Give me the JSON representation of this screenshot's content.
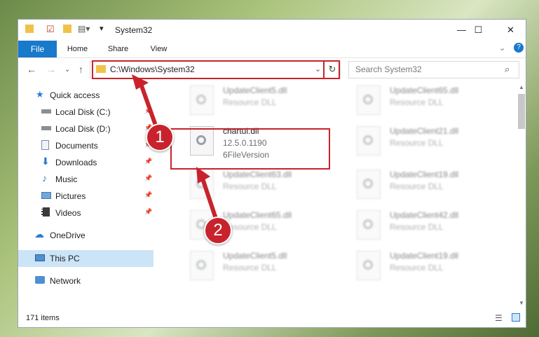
{
  "window": {
    "title": "System32",
    "controls": {
      "minimize": "—",
      "maximize": "☐",
      "close": "✕"
    }
  },
  "ribbon": {
    "tabs": [
      "File",
      "Home",
      "Share",
      "View"
    ]
  },
  "nav": {
    "address": "C:\\Windows\\System32",
    "search_placeholder": "Search System32"
  },
  "sidebar": {
    "items": [
      {
        "label": "Quick access",
        "icon": "star-icon"
      },
      {
        "label": "Local Disk (C:)",
        "icon": "drive-icon"
      },
      {
        "label": "Local Disk (D:)",
        "icon": "drive-icon"
      },
      {
        "label": "Documents",
        "icon": "documents-icon"
      },
      {
        "label": "Downloads",
        "icon": "download-icon"
      },
      {
        "label": "Music",
        "icon": "music-icon"
      },
      {
        "label": "Pictures",
        "icon": "pictures-icon"
      },
      {
        "label": "Videos",
        "icon": "videos-icon"
      },
      {
        "label": "OneDrive",
        "icon": "cloud-icon"
      },
      {
        "label": "This PC",
        "icon": "computer-icon"
      },
      {
        "label": "Network",
        "icon": "network-icon"
      }
    ]
  },
  "files": {
    "highlighted": {
      "name": "chartui.dll",
      "version": "12.5.0.1190",
      "description": "6FileVersion"
    },
    "others": [
      {
        "name": "UpdateClient5.dll",
        "desc": "Resource DLL"
      },
      {
        "name": "UpdateClient65.dll",
        "desc": "Resource DLL"
      },
      {
        "name": "UpdateClient21.dll",
        "desc": "Resource DLL"
      },
      {
        "name": "UpdateClient63.dll",
        "desc": "Resource DLL"
      },
      {
        "name": "UpdateClient19.dll",
        "desc": "Resource DLL"
      },
      {
        "name": "UpdateClient65.dll",
        "desc": "Resource DLL"
      },
      {
        "name": "UpdateClient42.dll",
        "desc": "Resource DLL"
      },
      {
        "name": "UpdateClient5.dll",
        "desc": "Resource DLL"
      },
      {
        "name": "UpdateClient19.dll",
        "desc": "Resource DLL"
      }
    ]
  },
  "status": {
    "item_count": "171 items"
  },
  "annotations": {
    "marker1": "1",
    "marker2": "2",
    "color": "#c8232c"
  }
}
